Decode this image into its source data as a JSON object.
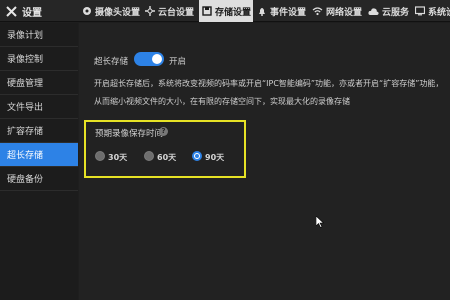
{
  "header": {
    "app_title": "设置",
    "tabs": [
      {
        "label": "摄像头设置",
        "icon": "camera-icon",
        "active": false
      },
      {
        "label": "云台设置",
        "icon": "ptz-icon",
        "active": false
      },
      {
        "label": "存储设置",
        "icon": "storage-icon",
        "active": true
      },
      {
        "label": "事件设置",
        "icon": "bell-icon",
        "active": false
      },
      {
        "label": "网络设置",
        "icon": "wifi-icon",
        "active": false
      },
      {
        "label": "云服务",
        "icon": "cloud-icon",
        "active": false
      },
      {
        "label": "系统设",
        "icon": "system-icon",
        "active": false
      }
    ]
  },
  "sidebar": {
    "items": [
      {
        "label": "录像计划",
        "active": false
      },
      {
        "label": "录像控制",
        "active": false
      },
      {
        "label": "硬盘管理",
        "active": false
      },
      {
        "label": "文件导出",
        "active": false
      },
      {
        "label": "扩容存储",
        "active": false
      },
      {
        "label": "超长存储",
        "active": true
      },
      {
        "label": "硬盘备份",
        "active": false
      }
    ]
  },
  "main": {
    "toggle_label": "超长存储",
    "toggle_state": "开启",
    "toggle_on": true,
    "desc_line1": "开启超长存储后，系统将改变视频的码率或开启“IPC智能编码”功能，亦或者开启“扩容存储”功能，",
    "desc_line2": "从而缩小视频文件的大小，在有限的存储空间下，实现最大化的录像存储",
    "days_title": "预期录像保存时间",
    "help_glyph": "?",
    "options": [
      {
        "label": "30天",
        "checked": false
      },
      {
        "label": "60天",
        "checked": false
      },
      {
        "label": "90天",
        "checked": true
      }
    ]
  },
  "colors": {
    "accent": "#2d82e6",
    "highlight_box": "#e6e225",
    "background": "#222222",
    "sidebar": "#1c1c1c"
  }
}
